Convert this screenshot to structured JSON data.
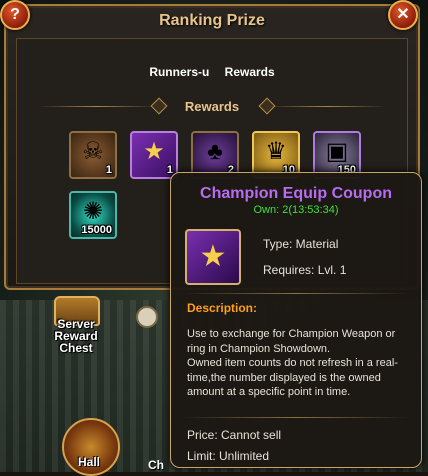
{
  "window": {
    "title": "Ranking Prize",
    "help_label": "?",
    "close_label": "✕"
  },
  "tabs": [
    {
      "label": "Runners-u"
    },
    {
      "label": "Rewards"
    }
  ],
  "rewards": {
    "header": "Rewards",
    "items": [
      {
        "icon": "warrior-mask-icon",
        "glyph": "☠",
        "qty": "1"
      },
      {
        "icon": "champion-coupon-icon",
        "glyph": "★",
        "qty": "1"
      },
      {
        "icon": "purple-pouch-icon",
        "glyph": "♣",
        "qty": "2"
      },
      {
        "icon": "golden-crest-icon",
        "glyph": "♛",
        "qty": "10"
      },
      {
        "icon": "silver-chest-icon",
        "glyph": "▣",
        "qty": "150"
      },
      {
        "icon": "teal-orb-icon",
        "glyph": "✺",
        "qty": "15000"
      }
    ]
  },
  "scene": {
    "server_chest_label": "Server Reward Chest",
    "hall_label": "Hall",
    "ch_label": "Ch"
  },
  "tooltip": {
    "title": "Champion Equip Coupon",
    "own": "Own: 2(13:53:34)",
    "icon": "champion-coupon-icon",
    "type": "Type: Material",
    "requires": "Requires: Lvl. 1",
    "description_header": "Description:",
    "description": "Use to exchange for Champion Weapon or ring in Champion Showdown.\nOwned item counts do not refresh in a real-time,the number displayed is the owned amount at a specific point in time.",
    "price": "Price: Cannot sell",
    "limit": "Limit: Unlimited"
  },
  "colors": {
    "title_gold": "#e7c58a",
    "tooltip_title_purple": "#b86cf0",
    "own_green": "#3ce03c",
    "description_orange": "#ff9e1a"
  }
}
